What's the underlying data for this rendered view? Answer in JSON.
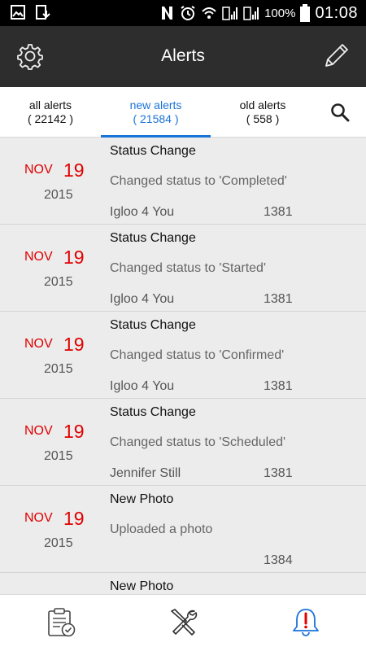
{
  "status_bar": {
    "battery_percent": "100%",
    "time": "01:08",
    "left_icons": [
      "image-icon",
      "download-icon"
    ],
    "right_icons": [
      "nfc-icon",
      "alarm-icon",
      "wifi-icon",
      "signal-icon",
      "signal-icon-2",
      "battery-icon"
    ]
  },
  "app_bar": {
    "title": "Alerts",
    "left_icon": "gear-icon",
    "right_icon": "pencil-icon"
  },
  "tabs": [
    {
      "label": "all alerts",
      "count": "( 22142 )",
      "active": false
    },
    {
      "label": "new alerts",
      "count": "( 21584 )",
      "active": true
    },
    {
      "label": "old alerts",
      "count": "( 558 )",
      "active": false
    }
  ],
  "search_icon": "search-icon",
  "alerts": [
    {
      "month": "NOV",
      "day": "19",
      "year": "2015",
      "title": "Status Change",
      "description": "Changed status to 'Completed'",
      "user": "Igloo 4 You",
      "number": "1381"
    },
    {
      "month": "NOV",
      "day": "19",
      "year": "2015",
      "title": "Status Change",
      "description": "Changed status to 'Started'",
      "user": "Igloo 4 You",
      "number": "1381"
    },
    {
      "month": "NOV",
      "day": "19",
      "year": "2015",
      "title": "Status Change",
      "description": "Changed status to 'Confirmed'",
      "user": "Igloo 4 You",
      "number": "1381"
    },
    {
      "month": "NOV",
      "day": "19",
      "year": "2015",
      "title": "Status Change",
      "description": "Changed status to 'Scheduled'",
      "user": "Jennifer Still",
      "number": "1381"
    },
    {
      "month": "NOV",
      "day": "19",
      "year": "2015",
      "title": "New Photo",
      "description": "Uploaded a photo",
      "user": "",
      "number": "1384"
    },
    {
      "month": "",
      "day": "",
      "year": "",
      "title": "New Photo",
      "description": "",
      "user": "",
      "number": ""
    }
  ],
  "bottom_nav": [
    {
      "icon": "clipboard-check-icon",
      "active": false
    },
    {
      "icon": "tools-icon",
      "active": false
    },
    {
      "icon": "alert-bell-icon",
      "active": true
    }
  ],
  "colors": {
    "accent": "#1a73d9",
    "date_red": "#e00000",
    "app_bar": "#2d2d2d"
  }
}
